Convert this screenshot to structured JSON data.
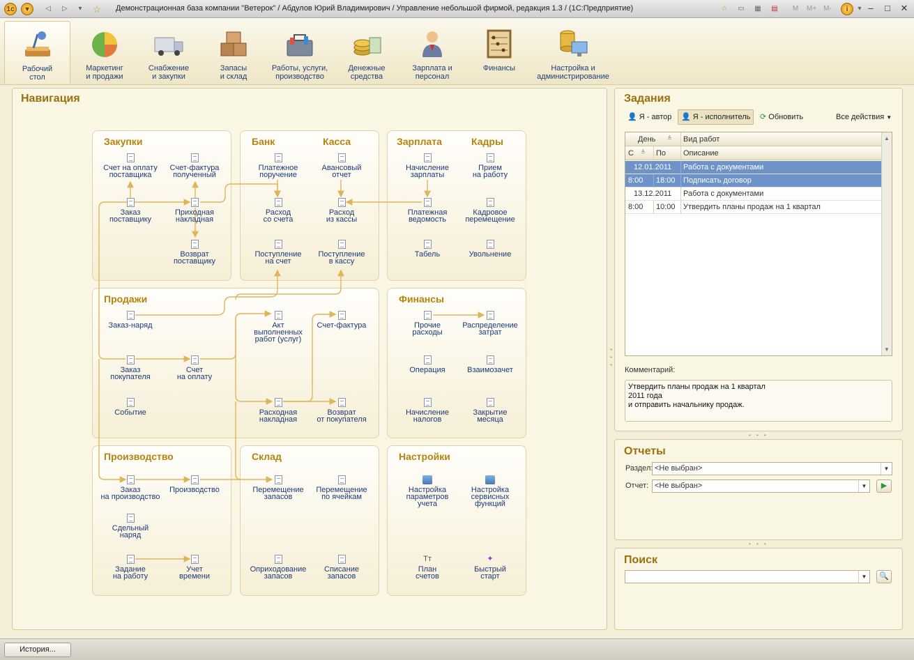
{
  "window": {
    "title": "Демонстрационная база компании \"Ветерок\" / Абдулов Юрий Владимирович /  Управление небольшой фирмой, редакция 1.3 /  (1С:Предприятие)",
    "toolbar_right": [
      "M",
      "M+",
      "M-"
    ]
  },
  "sections": [
    {
      "label": "Рабочий\nстол",
      "icon": "desk-lamp-icon",
      "active": true
    },
    {
      "label": "Маркетинг\nи продажи",
      "icon": "pie-chart-icon"
    },
    {
      "label": "Снабжение\nи закупки",
      "icon": "truck-icon"
    },
    {
      "label": "Запасы\nи склад",
      "icon": "boxes-icon"
    },
    {
      "label": "Работы, услуги,\nпроизводство",
      "icon": "toolbox-icon"
    },
    {
      "label": "Денежные\nсредства",
      "icon": "coins-icon"
    },
    {
      "label": "Зарплата и\nперсонал",
      "icon": "person-icon"
    },
    {
      "label": "Финансы",
      "icon": "abacus-icon"
    },
    {
      "label": "Настройка и\nадминистрирование",
      "icon": "database-computer-icon"
    }
  ],
  "navigation": {
    "title": "Навигация",
    "groups": {
      "zakupki": {
        "title": "Закупки"
      },
      "bank": {
        "title": "Банк"
      },
      "kassa": {
        "title": "Касса"
      },
      "zarplata": {
        "title": "Зарплата"
      },
      "kadry": {
        "title": "Кадры"
      },
      "prodazhi": {
        "title": "Продажи"
      },
      "finansy": {
        "title": "Финансы"
      },
      "proizvodstvo": {
        "title": "Производство"
      },
      "sklad": {
        "title": "Склад"
      },
      "nastroyki": {
        "title": "Настройки"
      }
    },
    "items": [
      {
        "id": "schet-na-oplatu-postavshchika",
        "label": "Счет на оплату\nпоставщика"
      },
      {
        "id": "schet-faktura-poluchennyy",
        "label": "Счет-фактура\nполученный"
      },
      {
        "id": "zakaz-postavshchiku",
        "label": "Заказ\nпоставщику"
      },
      {
        "id": "prikhodnaya-nakladnaya",
        "label": "Приходная\nнакладная"
      },
      {
        "id": "vozvrat-postavshchiku",
        "label": "Возврат\nпоставщику"
      },
      {
        "id": "platezhnoe-poruchenie",
        "label": "Платежное\nпоручение"
      },
      {
        "id": "avansovyy-otchet",
        "label": "Авансовый\nотчет"
      },
      {
        "id": "raskhod-so-scheta",
        "label": "Расход\nсо счета"
      },
      {
        "id": "raskhod-iz-kassy",
        "label": "Расход\nиз кассы"
      },
      {
        "id": "postuplenie-na-schet",
        "label": "Поступление\nна счет"
      },
      {
        "id": "postuplenie-v-kassu",
        "label": "Поступление\nв кассу"
      },
      {
        "id": "nachislenie-zarplaty",
        "label": "Начисление\nзарплаты"
      },
      {
        "id": "priem-na-rabotu",
        "label": "Прием\nна работу"
      },
      {
        "id": "platezhnaya-vedomost",
        "label": "Платежная\nведомость"
      },
      {
        "id": "kadrovoe-peremeshchenie",
        "label": "Кадровое\nперемещение"
      },
      {
        "id": "tabel",
        "label": "Табель"
      },
      {
        "id": "uvolnenie",
        "label": "Увольнение"
      },
      {
        "id": "zakaz-naryad",
        "label": "Заказ-наряд"
      },
      {
        "id": "akt-vypolnennykh-rabot",
        "label": "Акт\nвыполненных\nработ (услуг)"
      },
      {
        "id": "schet-faktura",
        "label": "Счет-фактура"
      },
      {
        "id": "zakaz-pokupatelya",
        "label": "Заказ\nпокупателя"
      },
      {
        "id": "schet-na-oplatu",
        "label": "Счет\nна оплату"
      },
      {
        "id": "sobytie",
        "label": "Событие"
      },
      {
        "id": "raskhodnaya-nakladnaya",
        "label": "Расходная\nнакладная"
      },
      {
        "id": "vozvrat-ot-pokupatelya",
        "label": "Возврат\nот покупателя"
      },
      {
        "id": "prochie-raskhody",
        "label": "Прочие\nрасходы"
      },
      {
        "id": "raspredelenie-zatrat",
        "label": "Распределение\nзатрат"
      },
      {
        "id": "operatsiya",
        "label": "Операция"
      },
      {
        "id": "vzaimozachet",
        "label": "Взаимозачет"
      },
      {
        "id": "nachislenie-nalogov",
        "label": "Начисление\nналогов"
      },
      {
        "id": "zakrytie-mesyatsa",
        "label": "Закрытие\nмесяца"
      },
      {
        "id": "zakaz-na-proizvodstvo",
        "label": "Заказ\nна производство"
      },
      {
        "id": "proizvodstvo",
        "label": "Производство"
      },
      {
        "id": "sdelnyy-naryad",
        "label": "Сдельный\nнаряд"
      },
      {
        "id": "zadanie-na-rabotu",
        "label": "Задание\nна работу"
      },
      {
        "id": "uchet-vremeni",
        "label": "Учет\nвремени"
      },
      {
        "id": "peremeshchenie-zapasov",
        "label": "Перемещение\nзапасов"
      },
      {
        "id": "peremeshchenie-po-yacheykam",
        "label": "Перемещение\nпо ячейкам"
      },
      {
        "id": "oprikhodovanie-zapasov",
        "label": "Оприходование\nзапасов"
      },
      {
        "id": "spisanie-zapasov",
        "label": "Списание\nзапасов"
      },
      {
        "id": "nastroyka-parametrov-ucheta",
        "label": "Настройка\nпараметров\nучета"
      },
      {
        "id": "nastroyka-servisnykh-funktsiy",
        "label": "Настройка\nсервисных\nфункций"
      },
      {
        "id": "plan-schetov",
        "label": "План\nсчетов"
      },
      {
        "id": "bystryy-start",
        "label": "Быстрый\nстарт"
      }
    ]
  },
  "tasks": {
    "title": "Задания",
    "buttons": {
      "author": "Я - автор",
      "executor": "Я - исполнитель",
      "refresh": "Обновить",
      "all_actions": "Все действия"
    },
    "columns": {
      "day": "День",
      "work_type": "Вид работ",
      "from": "С",
      "to": "По",
      "description": "Описание"
    },
    "rows": [
      {
        "kind": "group",
        "date": "12.01.2011",
        "text": "Работа с документами",
        "selected": true
      },
      {
        "kind": "task",
        "from": "8:00",
        "to": "18:00",
        "text": "Подписать договор",
        "selected": true
      },
      {
        "kind": "group",
        "date": "13.12.2011",
        "text": "Работа с документами"
      },
      {
        "kind": "task",
        "from": "8:00",
        "to": "10:00",
        "text": "Утвердить планы продаж на 1 квартал"
      }
    ],
    "comment_label": "Комментарий:",
    "comment_lines": [
      "Утвердить планы продаж на 1 квартал",
      "2011 года",
      "и отправить начальнику продаж."
    ]
  },
  "reports": {
    "title": "Отчеты",
    "section_label": "Раздел:",
    "section_value": "<Не выбран>",
    "report_label": "Отчет:",
    "report_value": "<Не выбран>"
  },
  "search": {
    "title": "Поиск",
    "value": ""
  },
  "statusbar": {
    "history_button": "История..."
  },
  "colors": {
    "accent_title": "#9a6f10",
    "group_title": "#b48410",
    "link": "#1a3a78",
    "selection": "#6d93c8",
    "arrow": "#e0b55a"
  }
}
